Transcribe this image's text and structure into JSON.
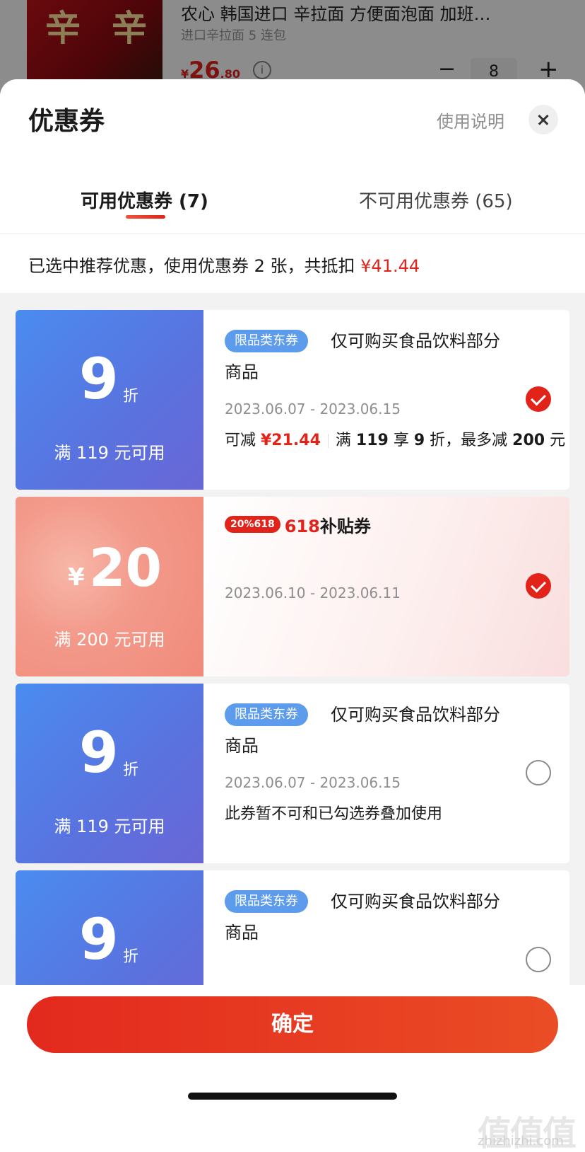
{
  "background_product": {
    "thumb_glyph": "辛",
    "title": "农心 韩国进口 辛拉面 方便面泡面 加班…",
    "subtitle": "进口辛拉面 5 连包",
    "price_symbol": "¥",
    "price_int": "26",
    "price_dec": ".80",
    "info_icon": "ⓘ",
    "minus": "−",
    "quantity": "8",
    "plus": "+"
  },
  "sheet": {
    "title": "优惠券",
    "help_link": "使用说明",
    "tabs": [
      {
        "label": "可用优惠券 (7)",
        "active": true
      },
      {
        "label": "不可用优惠券 (65)",
        "active": false
      }
    ],
    "summary_text": "已选中推荐优惠，使用优惠券 2 张，共抵扣 ",
    "summary_amount": "¥41.44"
  },
  "coupons": [
    {
      "style": "blue",
      "value": "9",
      "unit": "折",
      "condition": "满 119 元可用",
      "tag": "限品类东券",
      "desc_line1": "仅可购买食品饮料部分",
      "desc_line2": "商品",
      "date": "2023.06.07 - 2023.06.15",
      "detail_prefix": "可减 ",
      "detail_amount": "¥21.44",
      "detail_rule_a": "满 ",
      "detail_rule_b": "119",
      "detail_rule_c": " 享 ",
      "detail_rule_d": "9",
      "detail_rule_e": " 折，最多减 ",
      "detail_rule_f": "200",
      "detail_rule_g": " 元",
      "selected": true
    },
    {
      "style": "pink",
      "currency": "¥",
      "value": "20",
      "condition": "满 200 元可用",
      "badge_pill": "20%618",
      "badge_red": "618",
      "badge_black": "补贴券",
      "date": "2023.06.10 - 2023.06.11",
      "selected": true
    },
    {
      "style": "blue",
      "value": "9",
      "unit": "折",
      "condition": "满 119 元可用",
      "tag": "限品类东券",
      "desc_line1": "仅可购买食品饮料部分",
      "desc_line2": "商品",
      "date": "2023.06.07 - 2023.06.15",
      "note": "此券暂不可和已勾选券叠加使用",
      "selected": false
    },
    {
      "style": "blue",
      "value": "9",
      "unit": "折",
      "tag": "限品类东券",
      "desc_line1": "仅可购买食品饮料部分",
      "desc_line2": "商品",
      "selected": false
    }
  ],
  "confirm_label": "确定",
  "watermark": {
    "logo": "值值值",
    "url": "zhizhizhi.com"
  },
  "colors": {
    "accent": "#e2231a",
    "blue_coupon": "#5a72de",
    "tag_blue": "#5d9cec"
  }
}
